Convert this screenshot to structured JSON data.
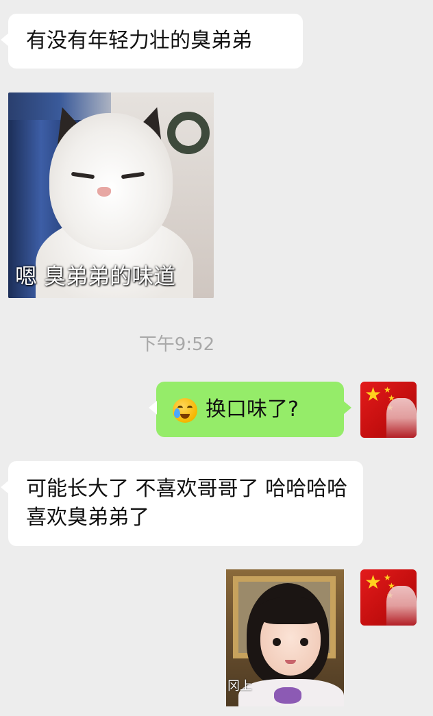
{
  "colors": {
    "background": "#ededed",
    "incoming_bubble": "#ffffff",
    "outgoing_bubble": "#95ec69",
    "timestamp_text": "#a8a8a8"
  },
  "messages": [
    {
      "direction": "incoming",
      "type": "text",
      "text": "有没有年轻力壮的臭弟弟"
    },
    {
      "direction": "incoming",
      "type": "sticker",
      "sticker": "cat-meme",
      "caption": "嗯 臭弟弟的味道"
    },
    {
      "type": "timestamp",
      "text": "下午9:52"
    },
    {
      "direction": "outgoing",
      "type": "text",
      "emoji": "loudly-crying-face-emoji",
      "text": "换口味了?"
    },
    {
      "direction": "incoming",
      "type": "text",
      "text": "可能长大了 不喜欢哥哥了 哈哈哈哈喜欢臭弟弟了"
    },
    {
      "direction": "outgoing",
      "type": "sticker",
      "sticker": "little-girl-meme",
      "watermark": "冈上"
    }
  ],
  "avatars": {
    "self": {
      "icon": "chinese-flag-avatar"
    }
  }
}
